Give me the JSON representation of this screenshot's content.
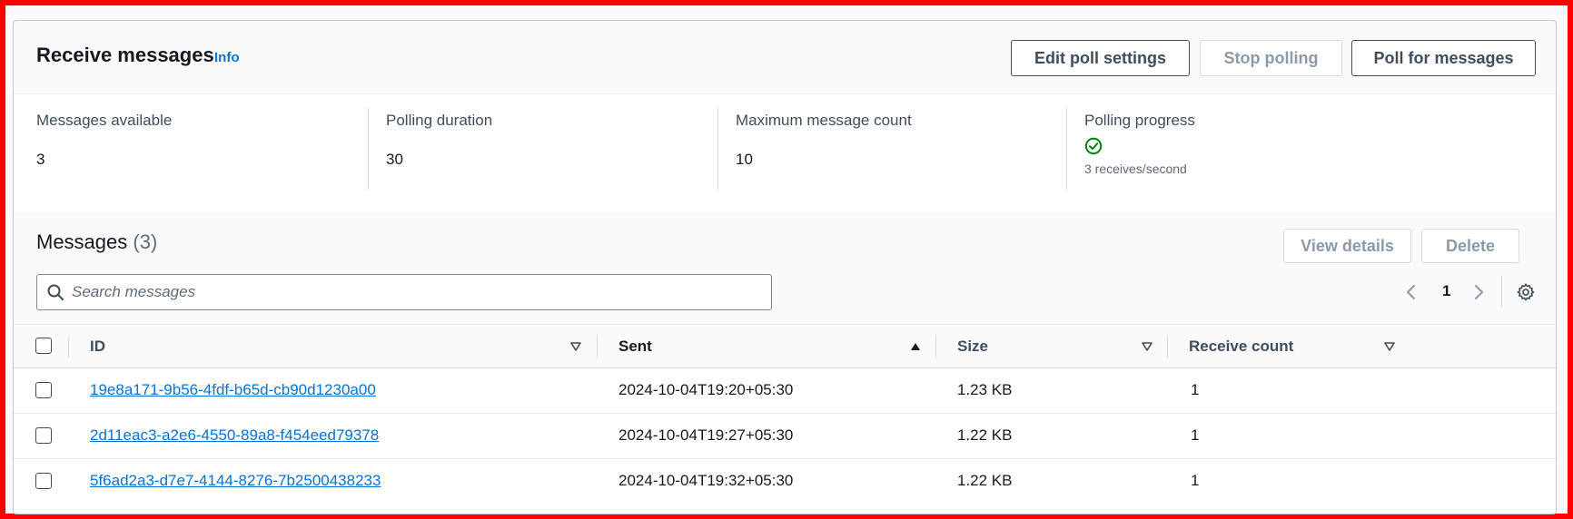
{
  "header": {
    "title": "Receive messages",
    "info": "Info",
    "edit_poll_settings": "Edit poll settings",
    "stop_polling": "Stop polling",
    "poll_for_messages": "Poll for messages"
  },
  "stats": {
    "messages_available_label": "Messages available",
    "messages_available_value": "3",
    "polling_duration_label": "Polling duration",
    "polling_duration_value": "30",
    "max_message_count_label": "Maximum message count",
    "max_message_count_value": "10",
    "polling_progress_label": "Polling progress",
    "polling_progress_status_icon": "check-circle-icon",
    "polling_progress_rate": "3 receives/second"
  },
  "messages": {
    "title": "Messages",
    "count": "(3)",
    "view_details": "View details",
    "delete": "Delete",
    "search_placeholder": "Search messages",
    "page": "1",
    "columns": {
      "id": "ID",
      "sent": "Sent",
      "size": "Size",
      "receive_count": "Receive count"
    },
    "rows": [
      {
        "id": "19e8a171-9b56-4fdf-b65d-cb90d1230a00",
        "sent": "2024-10-04T19:20+05:30",
        "size": "1.23 KB",
        "receive_count": "1"
      },
      {
        "id": "2d11eac3-a2e6-4550-89a8-f454eed79378",
        "sent": "2024-10-04T19:27+05:30",
        "size": "1.22 KB",
        "receive_count": "1"
      },
      {
        "id": "5f6ad2a3-d7e7-4144-8276-7b2500438233",
        "sent": "2024-10-04T19:32+05:30",
        "size": "1.22 KB",
        "receive_count": "1"
      }
    ]
  },
  "colors": {
    "link": "#0972d3",
    "success": "#037f0c",
    "frame_border": "#ff0000"
  }
}
